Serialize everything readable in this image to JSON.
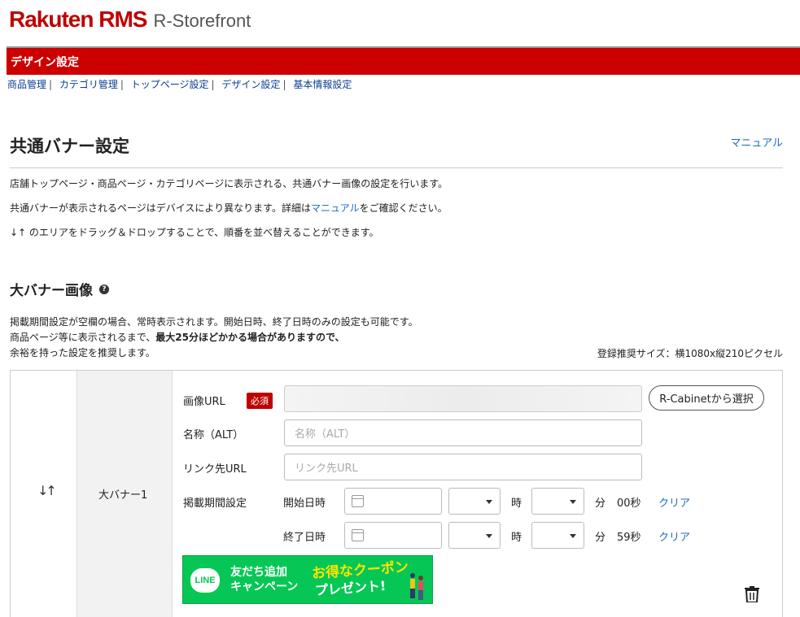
{
  "header": {
    "logo_main": "Rakuten RMS",
    "logo_sub": "R-Storefront",
    "section_bar": "デザイン設定"
  },
  "breadcrumb": [
    {
      "label": "商品管理"
    },
    {
      "label": "カテゴリ管理"
    },
    {
      "label": "トップページ設定"
    },
    {
      "label": "デザイン設定"
    },
    {
      "label": "基本情報設定"
    }
  ],
  "page": {
    "title": "共通バナー設定",
    "manual_link": "マニュアル",
    "desc1": "店舗トップページ・商品ページ・カテゴリページに表示される、共通バナー画像の設定を行います。",
    "desc2_before": "共通バナーが表示されるページはデバイスにより異なります。詳細は",
    "desc2_link": "マニュアル",
    "desc2_after": "をご確認ください。",
    "desc3": "↓↑ のエリアをドラッグ＆ドロップすることで、順番を並べ替えることができます。"
  },
  "large_banner": {
    "section_title": "大バナー画像",
    "help_icon": "question-circle-icon",
    "note_line1": "掲載期間設定が空欄の場合、常時表示されます。開始日時、終了日時のみの設定も可能です。",
    "note_line2_before": "商品ページ等に表示されるまで、",
    "note_line2_bold": "最大25分ほどかかる場合がありますので、",
    "note_line3": "余裕を持った設定を推奨します。",
    "size_note": "登録推奨サイズ：横1080x縦210ピクセル",
    "item": {
      "drag_icon": "↓↑",
      "name": "大バナー1",
      "image_url_label": "画像URL",
      "required_badge": "必須",
      "image_url_value": "",
      "cabinet_button": "R-Cabinetから選択",
      "alt_label": "名称（ALT）",
      "alt_placeholder": "名称（ALT）",
      "link_label": "リンク先URL",
      "link_placeholder": "リンク先URL",
      "period_label": "掲載期間設定",
      "start_label": "開始日時",
      "end_label": "終了日時",
      "hour_unit": "時",
      "minute_unit": "分",
      "start_seconds": "00秒",
      "end_seconds": "59秒",
      "clear_label": "クリア"
    },
    "preview": {
      "line_logo": "LINE",
      "text1": "友だち追加",
      "text2": "キャンペーン",
      "text3": "お得なクーポン",
      "text4": "プレゼント!"
    }
  },
  "colors": {
    "brand_red": "#bf0000",
    "section_bar": "#cc0000",
    "link_blue": "#1a6cc6",
    "line_green": "#06c755"
  }
}
